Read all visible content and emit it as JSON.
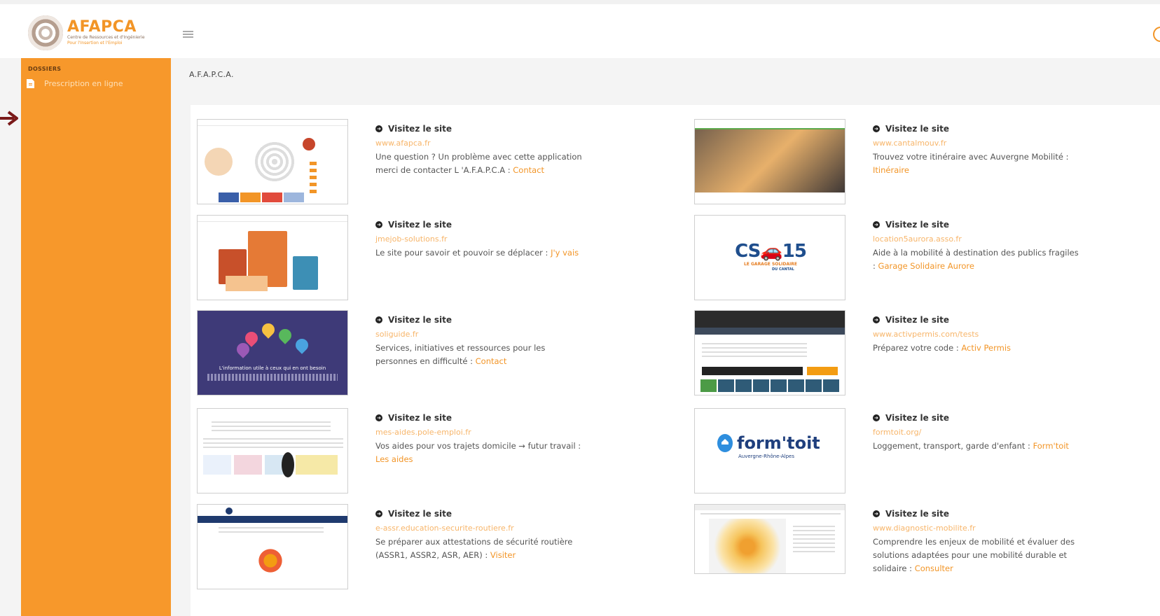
{
  "header": {
    "logo_name": "AFAPCA",
    "logo_subtitle_1": "Centre de Ressources et d'Ingénierie",
    "logo_subtitle_2": "Pour l'Insertion et l'Emploi"
  },
  "sidebar": {
    "section_title": "DOSSIERS",
    "items": [
      {
        "label": "Prescription en ligne"
      }
    ]
  },
  "breadcrumb": "A.F.A.P.C.A.",
  "cards": [
    {
      "heading": "Visitez le site",
      "url": "www.afapca.fr",
      "text": "Une question ? Un problème avec cette application merci de contacter L 'A.F.A.P.C.A :",
      "link": "Contact"
    },
    {
      "heading": "Visitez le site",
      "url": "www.cantalmouv.fr",
      "text": "Trouvez votre itinéraire avec Auvergne Mobilité :",
      "link": "Itinéraire"
    },
    {
      "heading": "Visitez le site",
      "url": "jmejob-solutions.fr",
      "text": "Le site pour savoir et pouvoir se déplacer :",
      "link": "J'y vais"
    },
    {
      "heading": "Visitez le site",
      "url": "location5aurora.asso.fr",
      "text": "Aide à la mobilité à destination des publics fragiles :",
      "link": "Garage Solidaire Aurore"
    },
    {
      "heading": "Visitez le site",
      "url": "soliguide.fr",
      "text": "Services, initiatives et ressources pour les personnes en difficulté :",
      "link": "Contact"
    },
    {
      "heading": "Visitez le site",
      "url": "www.activpermis.com/tests",
      "text": "Préparez votre code :",
      "link": "Activ Permis"
    },
    {
      "heading": "Visitez le site",
      "url": "mes-aides.pole-emploi.fr",
      "text": "Vos aides pour vos trajets domicile → futur travail :",
      "link": "Les aides"
    },
    {
      "heading": "Visitez le site",
      "url": "formtoit.org/",
      "text": "Loggement, transport, garde d'enfant :",
      "link": "Form'toit"
    },
    {
      "heading": "Visitez le site",
      "url": "e-assr.education-securite-routiere.fr",
      "text": "Se préparer aux attestations de sécurité routière (ASSR1, ASSR2, ASR, AER) :",
      "link": "Visiter"
    },
    {
      "heading": "Visitez le site",
      "url": "www.diagnostic-mobilite.fr",
      "text": "Comprendre les enjeux de mobilité et évaluer des solutions adaptées pour une mobilité durable et solidaire :",
      "link": "Consulter"
    }
  ],
  "thumbnails": {
    "soliguide_text": "L'information utile à ceux qui en ont besoin",
    "garage_title": "CS🚗15",
    "garage_sub": "LE GARAGE SOLIDAIRE",
    "garage_sub2": "DU CANTAL",
    "formtoit_name": "form'toit",
    "formtoit_sub": "Auvergne-Rhône-Alpes"
  },
  "colors": {
    "accent": "#f7982b",
    "link": "#f29527"
  }
}
